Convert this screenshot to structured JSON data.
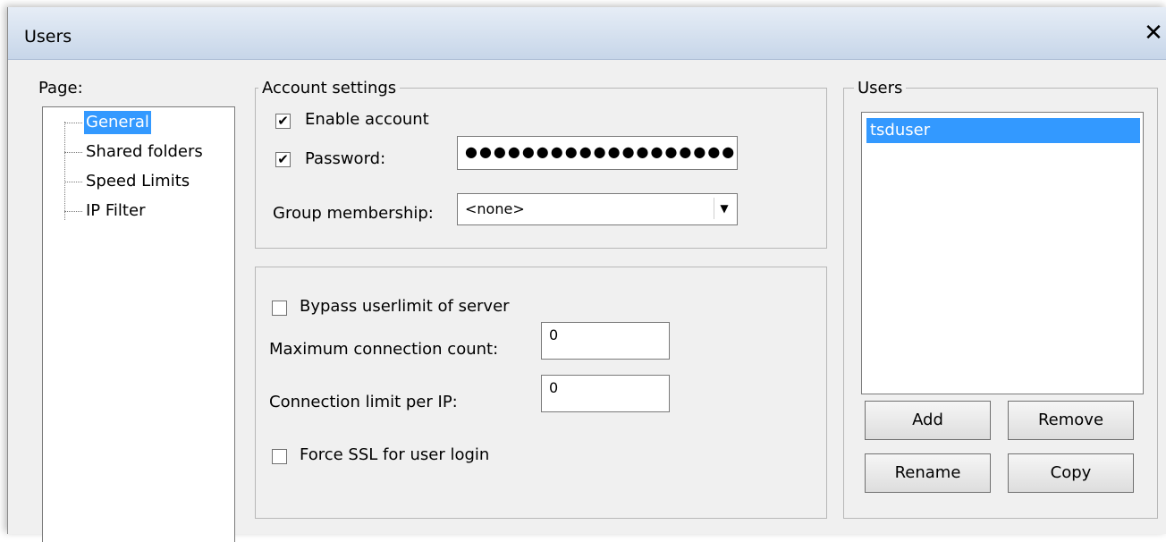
{
  "window": {
    "title": "Users",
    "close_glyph": "✕"
  },
  "page_panel": {
    "label": "Page:",
    "items": [
      {
        "label": "General",
        "selected": true
      },
      {
        "label": "Shared folders"
      },
      {
        "label": "Speed Limits"
      },
      {
        "label": "IP Filter"
      }
    ]
  },
  "account_settings": {
    "legend": "Account settings",
    "enable_account": {
      "label": "Enable account",
      "checked": true,
      "mark": "✔"
    },
    "password": {
      "label": "Password:",
      "checked": true,
      "mark": "✔",
      "value": "●●●●●●●●●●●●●●●●●●●●●●"
    },
    "group_membership": {
      "label": "Group membership:",
      "value": "<none>",
      "arrow": "▼"
    }
  },
  "limits": {
    "bypass_userlimit": {
      "label": "Bypass userlimit of server",
      "checked": false
    },
    "max_connection_count": {
      "label": "Maximum connection count:",
      "value": "0"
    },
    "connection_limit_per_ip": {
      "label": "Connection limit per IP:",
      "value": "0"
    },
    "force_ssl": {
      "label": "Force SSL for user login",
      "checked": false
    }
  },
  "users_panel": {
    "legend": "Users",
    "users": [
      {
        "name": "tsduser",
        "selected": true
      }
    ],
    "buttons": {
      "add": "Add",
      "remove": "Remove",
      "rename": "Rename",
      "copy": "Copy"
    }
  },
  "colors": {
    "title_bar_top": "#e6edf6",
    "title_bar_bottom": "#c7d6e9",
    "selection": "#3399ff",
    "dialog_bg": "#f0f0f0"
  }
}
